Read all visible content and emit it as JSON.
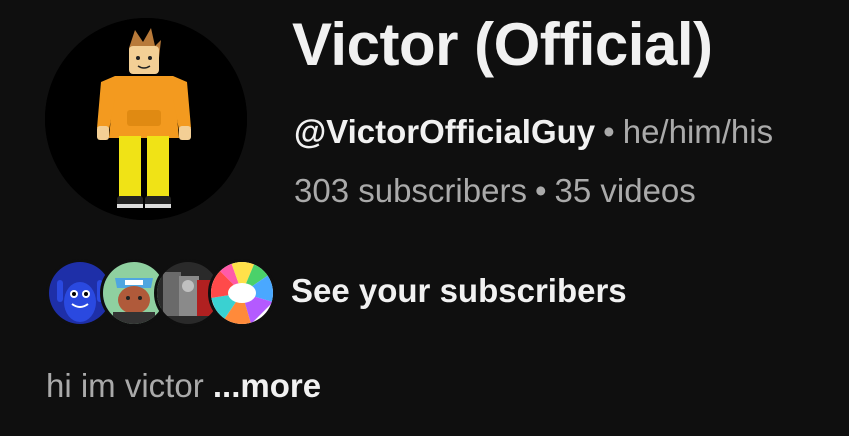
{
  "channel": {
    "name": "Victor (Official)",
    "handle": "@VictorOfficialGuy",
    "separator": "•",
    "pronouns": "he/him/his",
    "subscribers": "303 subscribers",
    "videos": "35 videos"
  },
  "subscribers_section": {
    "label": "See your subscribers",
    "avatars": [
      "subscriber-avatar-1",
      "subscriber-avatar-2",
      "subscriber-avatar-3",
      "subscriber-avatar-4"
    ]
  },
  "description": {
    "text": "hi im victor",
    "more_label": "...more"
  },
  "colors": {
    "background": "#0f0f0f",
    "primary_text": "#f1f1f1",
    "secondary_text": "#aaaaaa"
  }
}
